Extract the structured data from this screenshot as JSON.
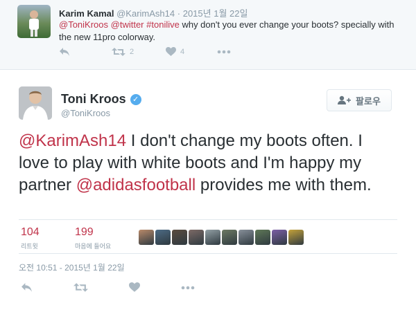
{
  "reply": {
    "name": "Karim Kamal",
    "handle": "@KarimAsh14",
    "separator": "·",
    "time": "2015년 1월 22일",
    "text_parts": [
      {
        "text": "@ToniKroos",
        "link": true
      },
      {
        "text": " ",
        "link": false
      },
      {
        "text": "@twitter",
        "link": true
      },
      {
        "text": " ",
        "link": false
      },
      {
        "text": "#tonilive",
        "link": true
      },
      {
        "text": " why don't you ever change your boots? specially with the new 11pro colorway.",
        "link": false
      }
    ],
    "retweet_count": "2",
    "like_count": "4"
  },
  "tweet": {
    "name": "Toni Kroos",
    "handle": "@ToniKroos",
    "follow_label": "팔로우",
    "text_parts": [
      {
        "text": "@KarimAsh14",
        "link": true
      },
      {
        "text": " I don't change my boots often. I love to play with white boots and I'm happy my partner ",
        "link": false
      },
      {
        "text": "@adidasfootball",
        "link": true
      },
      {
        "text": " provides me with them.",
        "link": false
      }
    ],
    "retweets": {
      "count": "104",
      "label": "리트윗"
    },
    "likes": {
      "count": "199",
      "label": "마음에 들어요"
    },
    "timestamp": "오전 10:51 - 2015년 1월 22일"
  },
  "colors": {
    "link": "#c0334a",
    "verified": "#55acee",
    "muted": "#8899a6",
    "icon": "#aab8c2"
  },
  "icons": {
    "reply": "reply-arrow-icon",
    "retweet": "retweet-icon",
    "like": "heart-icon",
    "more": "more-dots-icon",
    "verified": "verified-badge-icon",
    "follow": "person-plus-icon"
  },
  "liker_avatar_colors": [
    "#b98a6a",
    "#4d6b85",
    "#5a4b3f",
    "#7d6a66",
    "#93a0a5",
    "#6d7a63",
    "#88909a",
    "#5f7857",
    "#7c5ea6",
    "#c4a23a"
  ]
}
